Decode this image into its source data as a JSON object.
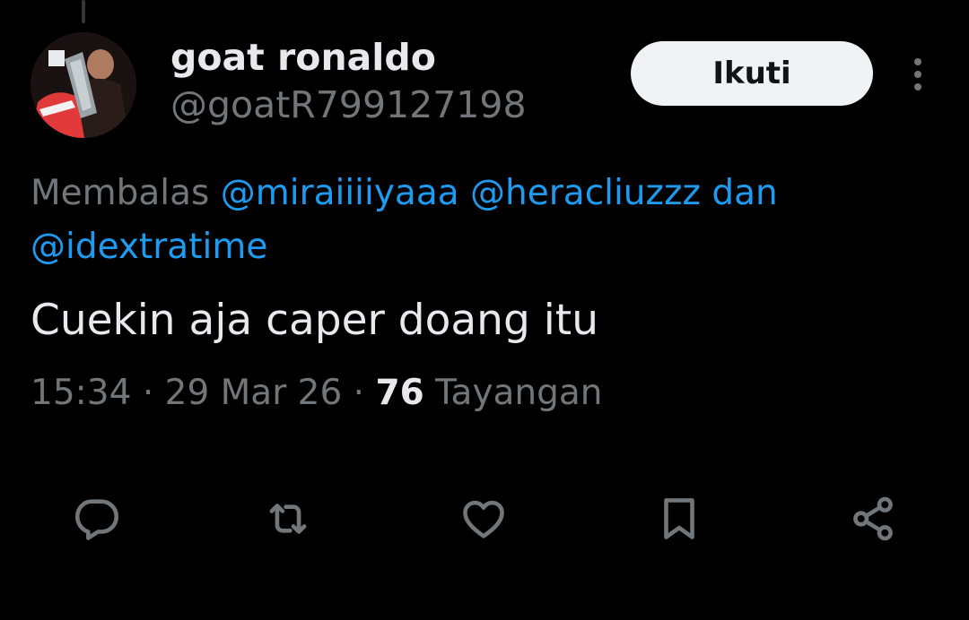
{
  "tweet": {
    "display_name": "goat ronaldo",
    "handle": "@goatR799127198",
    "follow_label": "Ikuti",
    "reply_prefix": "Membalas",
    "mentions": [
      "@miraiiiiyaaa",
      "@heracliuzzz",
      "@idextratime"
    ],
    "mention_joiner": "dan",
    "text": "Cuekin aja caper doang itu",
    "time": "15:34",
    "date": "29 Mar 26",
    "views_count": "76",
    "views_label": "Tayangan",
    "separator": "·"
  },
  "actions": {
    "reply_icon": "reply-icon",
    "retweet_icon": "retweet-icon",
    "like_icon": "heart-icon",
    "bookmark_icon": "bookmark-icon",
    "share_icon": "share-icon"
  },
  "colors": {
    "background": "#000000",
    "primary_text": "#e7e9ea",
    "secondary_text": "#71767b",
    "link": "#1d9bf0",
    "follow_button_bg": "#eff3f4"
  }
}
